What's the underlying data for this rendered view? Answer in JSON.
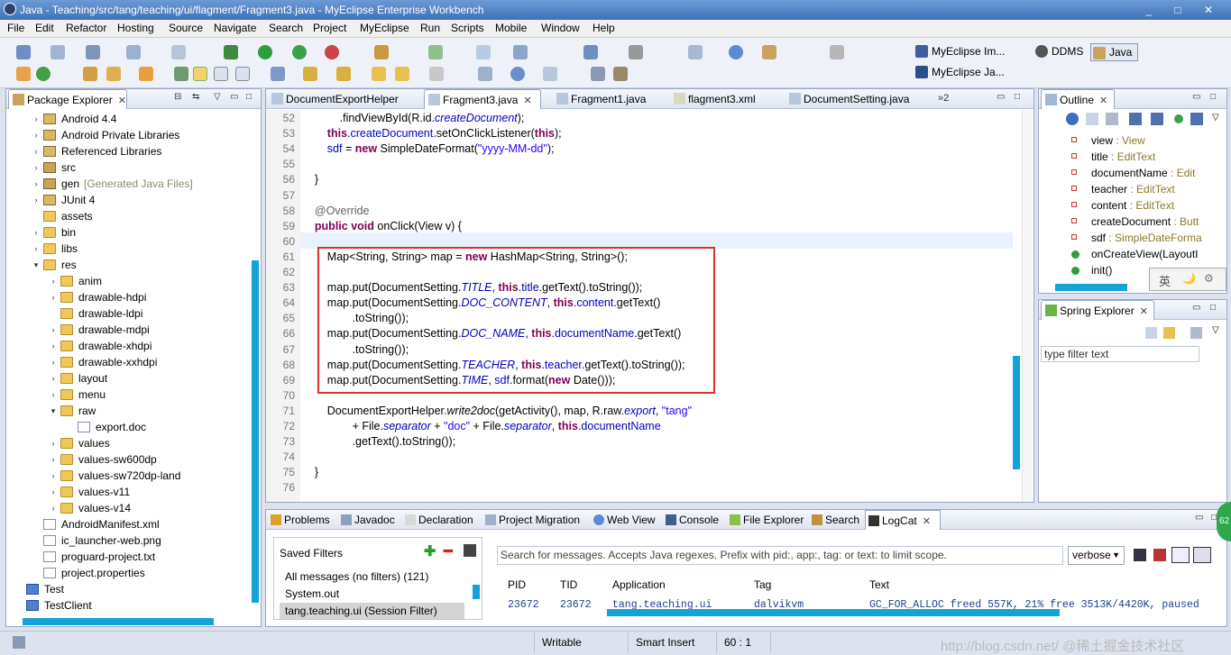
{
  "window": {
    "title": "Java - Teaching/src/tang/teaching/ui/flagment/Fragment3.java - MyEclipse Enterprise Workbench",
    "controls": [
      "_",
      "□",
      "✕"
    ]
  },
  "menu": [
    "File",
    "Edit",
    "Refactor",
    "Hosting",
    "Source",
    "Navigate",
    "Search",
    "Project",
    "MyEclipse",
    "Run",
    "Scripts",
    "Mobile",
    "Window",
    "Help"
  ],
  "perspectives": {
    "myeclipse_im": "MyEclipse Im...",
    "ddms": "DDMS",
    "java": "Java",
    "myeclipse_ja": "MyEclipse Ja..."
  },
  "package_explorer": {
    "title": "Package Explorer",
    "items": [
      {
        "label": "Android 4.4",
        "icon": "library-icon",
        "arrow": ">"
      },
      {
        "label": "Android Private Libraries",
        "icon": "library-icon",
        "arrow": ">"
      },
      {
        "label": "Referenced Libraries",
        "icon": "library-icon",
        "arrow": ">"
      },
      {
        "label": "src",
        "icon": "source-folder-icon",
        "arrow": ">"
      },
      {
        "label": "gen",
        "suffix": "[Generated Java Files]",
        "icon": "source-folder-icon",
        "arrow": ">"
      },
      {
        "label": "JUnit 4",
        "icon": "library-icon",
        "arrow": ">"
      },
      {
        "label": "assets",
        "icon": "folder-icon",
        "arrow": ""
      },
      {
        "label": "bin",
        "icon": "folder-icon",
        "arrow": ">"
      },
      {
        "label": "libs",
        "icon": "folder-icon",
        "arrow": ">"
      },
      {
        "label": "res",
        "icon": "folder-icon",
        "arrow": "v"
      },
      {
        "label": "anim",
        "icon": "folder-icon",
        "arrow": ">"
      },
      {
        "label": "drawable-hdpi",
        "icon": "folder-icon",
        "arrow": ">"
      },
      {
        "label": "drawable-ldpi",
        "icon": "folder-icon",
        "arrow": ""
      },
      {
        "label": "drawable-mdpi",
        "icon": "folder-icon",
        "arrow": ">"
      },
      {
        "label": "drawable-xhdpi",
        "icon": "folder-icon",
        "arrow": ">"
      },
      {
        "label": "drawable-xxhdpi",
        "icon": "folder-icon",
        "arrow": ">"
      },
      {
        "label": "layout",
        "icon": "folder-icon",
        "arrow": ">"
      },
      {
        "label": "menu",
        "icon": "folder-icon",
        "arrow": ">"
      },
      {
        "label": "raw",
        "icon": "folder-icon",
        "arrow": "v"
      },
      {
        "label": "export.doc",
        "icon": "doc-file-icon",
        "arrow": ""
      },
      {
        "label": "values",
        "icon": "folder-icon",
        "arrow": ">"
      },
      {
        "label": "values-sw600dp",
        "icon": "folder-icon",
        "arrow": ">"
      },
      {
        "label": "values-sw720dp-land",
        "icon": "folder-icon",
        "arrow": ">"
      },
      {
        "label": "values-v11",
        "icon": "folder-icon",
        "arrow": ">"
      },
      {
        "label": "values-v14",
        "icon": "folder-icon",
        "arrow": ">"
      },
      {
        "label": "AndroidManifest.xml",
        "icon": "xml-file-icon",
        "arrow": ""
      },
      {
        "label": "ic_launcher-web.png",
        "icon": "image-file-icon",
        "arrow": ""
      },
      {
        "label": "proguard-project.txt",
        "icon": "text-file-icon",
        "arrow": ""
      },
      {
        "label": "project.properties",
        "icon": "text-file-icon",
        "arrow": ""
      },
      {
        "label": "Test",
        "icon": "project-icon",
        "arrow": ""
      },
      {
        "label": "TestClient",
        "icon": "project-icon",
        "arrow": ""
      }
    ]
  },
  "editor_tabs": [
    {
      "label": "DocumentExportHelper",
      "active": false
    },
    {
      "label": "Fragment3.java",
      "active": true
    },
    {
      "label": "Fragment1.java",
      "active": false
    },
    {
      "label": "flagment3.xml",
      "active": false
    },
    {
      "label": "DocumentSetting.java",
      "active": false
    }
  ],
  "editor_overflow": "»2",
  "code_lines": [
    {
      "n": "52",
      "parts": [
        [
          "",
          "            .findViewById(R.id."
        ],
        [
          "itfld",
          "createDocument"
        ],
        [
          "",
          ");"
        ]
      ]
    },
    {
      "n": "53",
      "parts": [
        [
          "",
          "        "
        ],
        [
          "kw",
          "this"
        ],
        [
          "",
          "."
        ],
        [
          "fld",
          "createDocument"
        ],
        [
          "",
          ".setOnClickListener("
        ],
        [
          "kw",
          "this"
        ],
        [
          "",
          ");"
        ]
      ]
    },
    {
      "n": "54",
      "parts": [
        [
          "",
          "        "
        ],
        [
          "fld",
          "sdf"
        ],
        [
          "",
          " = "
        ],
        [
          "kw",
          "new"
        ],
        [
          "",
          " SimpleDateFormat("
        ],
        [
          "str",
          "\"yyyy-MM-dd\""
        ],
        [
          "",
          ");"
        ]
      ]
    },
    {
      "n": "55",
      "parts": []
    },
    {
      "n": "56",
      "parts": [
        [
          "",
          "    }"
        ]
      ]
    },
    {
      "n": "57",
      "parts": []
    },
    {
      "n": "58",
      "parts": [
        [
          "ann",
          "    @Override"
        ]
      ]
    },
    {
      "n": "59",
      "parts": [
        [
          "",
          "    "
        ],
        [
          "kw",
          "public"
        ],
        [
          "",
          " "
        ],
        [
          "kw",
          "void"
        ],
        [
          "",
          " onClick(View v) {"
        ]
      ]
    },
    {
      "n": "60",
      "parts": []
    },
    {
      "n": "61",
      "parts": [
        [
          "",
          "        Map<String, String> map = "
        ],
        [
          "kw",
          "new"
        ],
        [
          "",
          " HashMap<String, String>();"
        ]
      ]
    },
    {
      "n": "62",
      "parts": []
    },
    {
      "n": "63",
      "parts": [
        [
          "",
          "        map.put(DocumentSetting."
        ],
        [
          "itfld",
          "TITLE"
        ],
        [
          "",
          ", "
        ],
        [
          "kw",
          "this"
        ],
        [
          "",
          "."
        ],
        [
          "fld",
          "title"
        ],
        [
          "",
          ".getText().toString());"
        ]
      ]
    },
    {
      "n": "64",
      "parts": [
        [
          "",
          "        map.put(DocumentSetting."
        ],
        [
          "itfld",
          "DOC_CONTENT"
        ],
        [
          "",
          ", "
        ],
        [
          "kw",
          "this"
        ],
        [
          "",
          "."
        ],
        [
          "fld",
          "content"
        ],
        [
          "",
          ".getText()"
        ]
      ]
    },
    {
      "n": "65",
      "parts": [
        [
          "",
          "                .toString());"
        ]
      ]
    },
    {
      "n": "66",
      "parts": [
        [
          "",
          "        map.put(DocumentSetting."
        ],
        [
          "itfld",
          "DOC_NAME"
        ],
        [
          "",
          ", "
        ],
        [
          "kw",
          "this"
        ],
        [
          "",
          "."
        ],
        [
          "fld",
          "documentName"
        ],
        [
          "",
          ".getText()"
        ]
      ]
    },
    {
      "n": "67",
      "parts": [
        [
          "",
          "                .toString());"
        ]
      ]
    },
    {
      "n": "68",
      "parts": [
        [
          "",
          "        map.put(DocumentSetting."
        ],
        [
          "itfld",
          "TEACHER"
        ],
        [
          "",
          ", "
        ],
        [
          "kw",
          "this"
        ],
        [
          "",
          "."
        ],
        [
          "fld",
          "teacher"
        ],
        [
          "",
          ".getText().toString());"
        ]
      ]
    },
    {
      "n": "69",
      "parts": [
        [
          "",
          "        map.put(DocumentSetting."
        ],
        [
          "itfld",
          "TIME"
        ],
        [
          "",
          ", "
        ],
        [
          "fld",
          "sdf"
        ],
        [
          "",
          ".format("
        ],
        [
          "kw",
          "new"
        ],
        [
          "",
          " Date()));"
        ]
      ]
    },
    {
      "n": "70",
      "parts": []
    },
    {
      "n": "71",
      "parts": [
        [
          "",
          "        DocumentExportHelper."
        ],
        [
          "it",
          "write2doc"
        ],
        [
          "",
          "(getActivity(), map, R.raw."
        ],
        [
          "itfld",
          "export"
        ],
        [
          "",
          ", "
        ],
        [
          "str",
          "\"tang\""
        ]
      ]
    },
    {
      "n": "72",
      "parts": [
        [
          "",
          "                + File."
        ],
        [
          "itfld",
          "separator"
        ],
        [
          "",
          " + "
        ],
        [
          "str",
          "\"doc\""
        ],
        [
          "",
          " + File."
        ],
        [
          "itfld",
          "separator"
        ],
        [
          "",
          ", "
        ],
        [
          "kw",
          "this"
        ],
        [
          "",
          "."
        ],
        [
          "fld",
          "documentName"
        ]
      ]
    },
    {
      "n": "73",
      "parts": [
        [
          "",
          "                .getText().toString());"
        ]
      ]
    },
    {
      "n": "74",
      "parts": []
    },
    {
      "n": "75",
      "parts": [
        [
          "",
          "    }"
        ]
      ]
    },
    {
      "n": "76",
      "parts": []
    }
  ],
  "outline": {
    "title": "Outline",
    "items": [
      {
        "name": "view",
        "type": " : View",
        "kind": "field"
      },
      {
        "name": "title",
        "type": " : EditText",
        "kind": "field"
      },
      {
        "name": "documentName",
        "type": " : Edit",
        "kind": "field"
      },
      {
        "name": "teacher",
        "type": " : EditText",
        "kind": "field"
      },
      {
        "name": "content",
        "type": " : EditText",
        "kind": "field"
      },
      {
        "name": "createDocument",
        "type": " : Butt",
        "kind": "field"
      },
      {
        "name": "sdf",
        "type": " : SimpleDateForma",
        "kind": "field"
      },
      {
        "name": "onCreateView(LayoutI",
        "type": "",
        "kind": "method"
      },
      {
        "name": "init()",
        "type": "",
        "kind": "method"
      }
    ],
    "ime": [
      "英",
      "🌙",
      "⚙"
    ]
  },
  "spring_explorer": {
    "title": "Spring Explorer",
    "filter_placeholder": "type filter text"
  },
  "bottom_tabs": [
    "Problems",
    "Javadoc",
    "Declaration",
    "Project Migration",
    "Web View",
    "Console",
    "File Explorer",
    "Search",
    "LogCat"
  ],
  "logcat": {
    "saved_filters_label": "Saved Filters",
    "filters": [
      "All messages (no filters) (121)",
      "System.out",
      "tang.teaching.ui (Session Filter)"
    ],
    "search_placeholder": "Search for messages. Accepts Java regexes. Prefix with pid:, app:, tag: or text: to limit scope.",
    "level": "verbose",
    "columns": [
      "PID",
      "TID",
      "Application",
      "Tag",
      "Text"
    ],
    "row": [
      "23672",
      "23672",
      "tang.teaching.ui",
      "dalvikvm",
      "GC_FOR_ALLOC freed 557K, 21% free 3513K/4420K, paused"
    ]
  },
  "status": {
    "writable": "Writable",
    "insert": "Smart Insert",
    "position": "60 : 1"
  },
  "badge": "62",
  "watermark": "http://blog.csdn.net/  @稀土掘金技术社区",
  "colors": {
    "keyword": "#7f0055",
    "field": "#0000c0",
    "string": "#2a00ff",
    "highlight_box": "#d9312b",
    "accent_bar": "#14a3d8"
  }
}
